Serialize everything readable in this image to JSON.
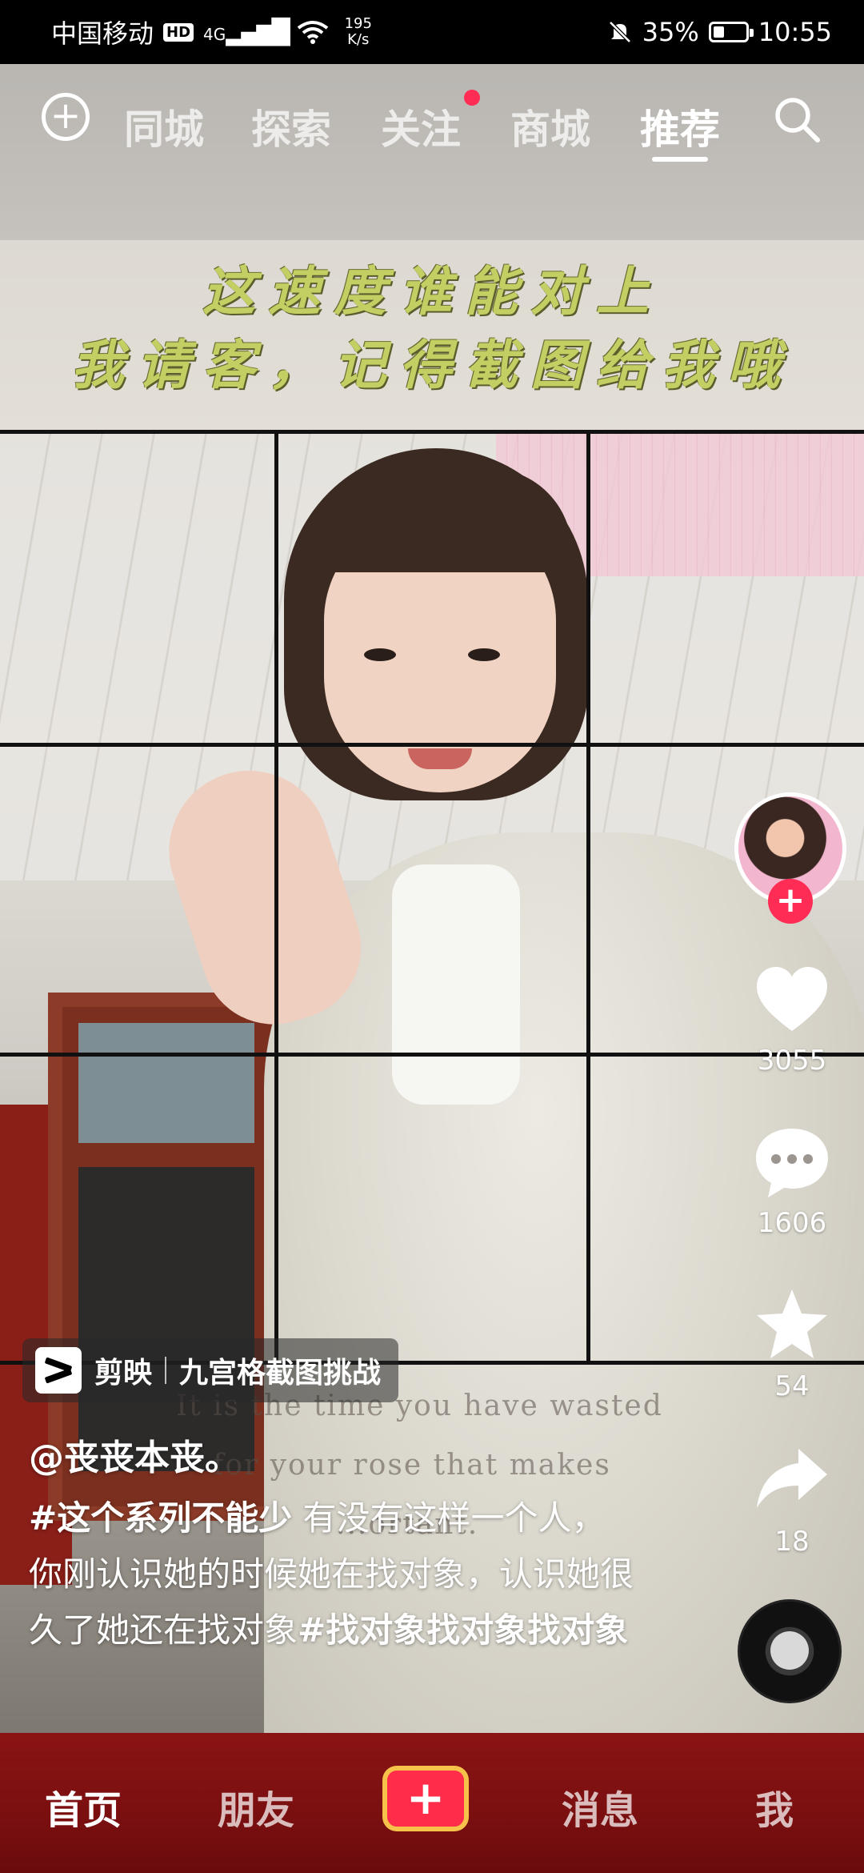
{
  "status_bar": {
    "carrier": "中国移动",
    "hd": "HD",
    "signal": "4G",
    "net_speed_value": "195",
    "net_speed_unit": "K/s",
    "battery_percent": "35%",
    "battery_level": 0.35,
    "time": "10:55"
  },
  "top_tabs": {
    "items": [
      "同城",
      "探索",
      "关注",
      "商城",
      "推荐"
    ],
    "active": "推荐"
  },
  "video": {
    "caption_line1": "这速度谁能对上",
    "caption_line2": "我请客，记得截图给我哦",
    "english_line1": "It is the time you have wasted",
    "english_line2": "for your rose that makes",
    "english_line3": "...ortant."
  },
  "actions": {
    "likes": "3055",
    "comments": "1606",
    "favorites": "54",
    "shares": "18"
  },
  "post": {
    "app_label": "剪映",
    "template_name": "九宫格截图挑战",
    "author": "@丧丧本丧。",
    "description_tag1": "#这个系列不能少",
    "description_text1": " 有没有这样一个人，你刚认识她的时候她在找对象，认识她很久了她还在找对象",
    "description_tag2": "#找对象找对象找对象"
  },
  "bottom_nav": {
    "home": "首页",
    "friends": "朋友",
    "plus": "+",
    "messages": "消息",
    "me": "我"
  },
  "colors": {
    "accent_red": "#ff2c55",
    "nav_bg": "#7a0f10",
    "caption_color": "#c4cf63"
  }
}
